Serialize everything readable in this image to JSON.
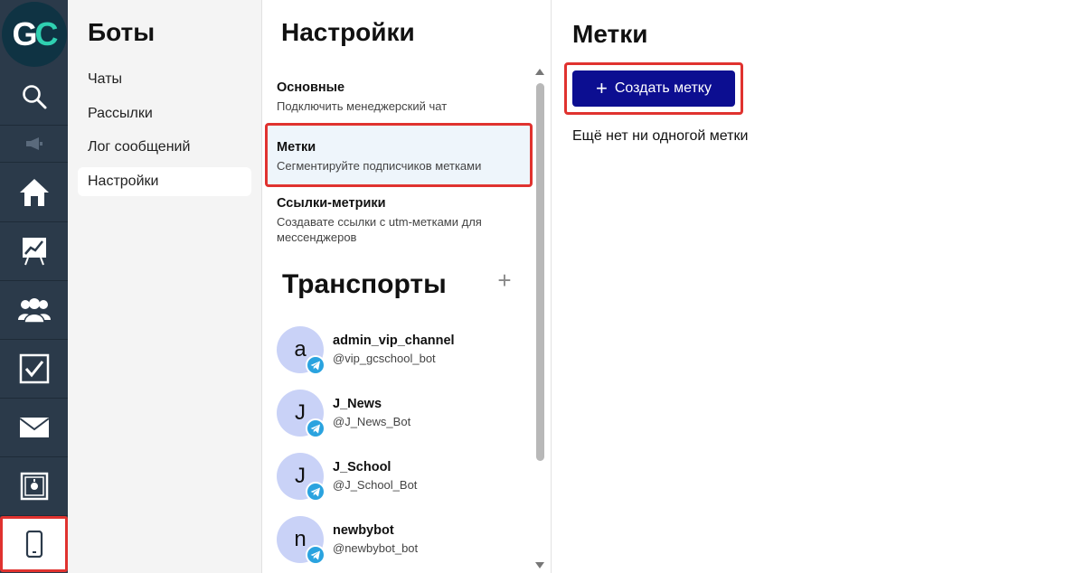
{
  "logo": {
    "letter_g": "G",
    "letter_c": "C"
  },
  "rail": {
    "icons": [
      "search-icon",
      "megaphone-icon",
      "home-icon",
      "chart-board-icon",
      "users-icon",
      "checkbox-icon",
      "mail-icon",
      "safe-icon",
      "phone-icon"
    ],
    "active": "phone-icon"
  },
  "bots": {
    "title": "Боты",
    "items": [
      {
        "label": "Чаты"
      },
      {
        "label": "Рассылки"
      },
      {
        "label": "Лог сообщений"
      },
      {
        "label": "Настройки",
        "active": true
      }
    ]
  },
  "settings": {
    "title": "Настройки",
    "items": [
      {
        "title": "Основные",
        "subtitle": "Подключить менеджерский чат"
      },
      {
        "title": "Метки",
        "subtitle": "Сегментируйте подписчиков метками",
        "active": true
      },
      {
        "title": "Ссылки-метрики",
        "subtitle": "Создавате ссылки с utm-метками для мессенджеров"
      }
    ],
    "transports_title": "Транспорты",
    "add_symbol": "+",
    "transports": [
      {
        "letter": "a",
        "name": "admin_vip_channel",
        "handle": "@vip_gcschool_bot"
      },
      {
        "letter": "J",
        "name": "J_News",
        "handle": "@J_News_Bot"
      },
      {
        "letter": "J",
        "name": "J_School",
        "handle": "@J_School_Bot"
      },
      {
        "letter": "n",
        "name": "newbybot",
        "handle": "@newbybot_bot"
      }
    ]
  },
  "main": {
    "title": "Метки",
    "create_button": {
      "plus": "+",
      "label": "Создать метку"
    },
    "empty_text": "Ещё нет ни одногой метки"
  },
  "colors": {
    "rail_bg": "#2b3a4a",
    "accent_button": "#0c0e91",
    "highlight_border": "#e0322f",
    "telegram": "#2aa3df",
    "avatar_bg": "#c9d2f7"
  }
}
